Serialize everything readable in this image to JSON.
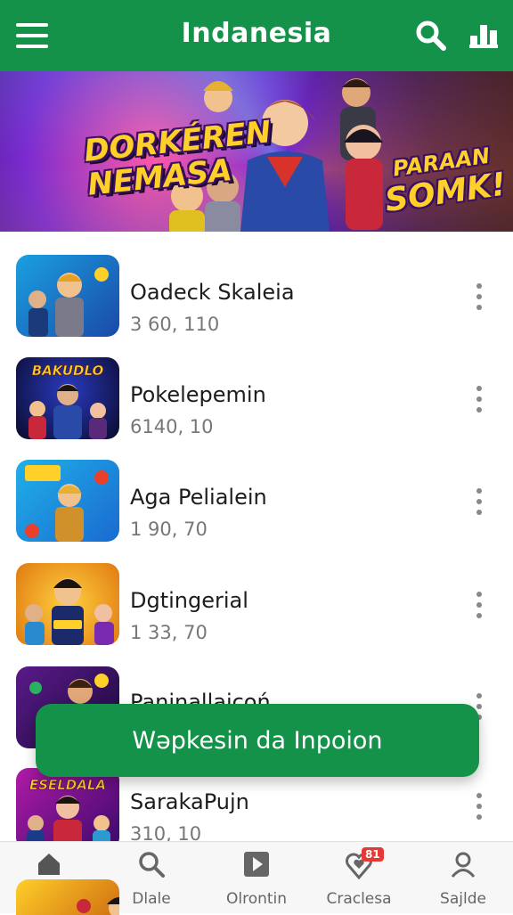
{
  "appbar": {
    "title": "Indanesia",
    "menu_icon": "hamburger-menu-icon",
    "search_icon": "search-icon",
    "chart_icon": "bar-chart-icon"
  },
  "banner": {
    "logo_left": [
      "DORKÉREN",
      "NEMASA"
    ],
    "logo_right": [
      "PARAAN",
      "SOMK!"
    ]
  },
  "list": {
    "items": [
      {
        "name": "Oadeck Skaleia",
        "count": "3 60, 110",
        "thumb_caption": ""
      },
      {
        "name": "Pokelepemin",
        "count": "6140, 10",
        "thumb_caption": "BAKUDLO"
      },
      {
        "name": "Aga Pelialein",
        "count": "1 90, 70",
        "thumb_caption": ""
      },
      {
        "name": "Dgtingerial",
        "count": "1 33, 70",
        "thumb_caption": ""
      },
      {
        "name": "Paninallaicoń",
        "count": "",
        "thumb_caption": ""
      },
      {
        "name": "SarakaPujn",
        "count": "310, 10",
        "thumb_caption": "ESELDALA"
      }
    ]
  },
  "toast": {
    "label": "Wəpkesin da Inpoion"
  },
  "bottomnav": {
    "items": [
      {
        "label": "",
        "icon": "home-icon"
      },
      {
        "label": "Dlale",
        "icon": "search-icon"
      },
      {
        "label": "Olrontin",
        "icon": "play-icon"
      },
      {
        "label": "Craclesa",
        "icon": "heart-location-icon",
        "badge": "81"
      },
      {
        "label": "Sajlde",
        "icon": "profile-icon"
      }
    ]
  },
  "colors": {
    "brand_green": "#15924a",
    "badge_red": "#e53935"
  }
}
